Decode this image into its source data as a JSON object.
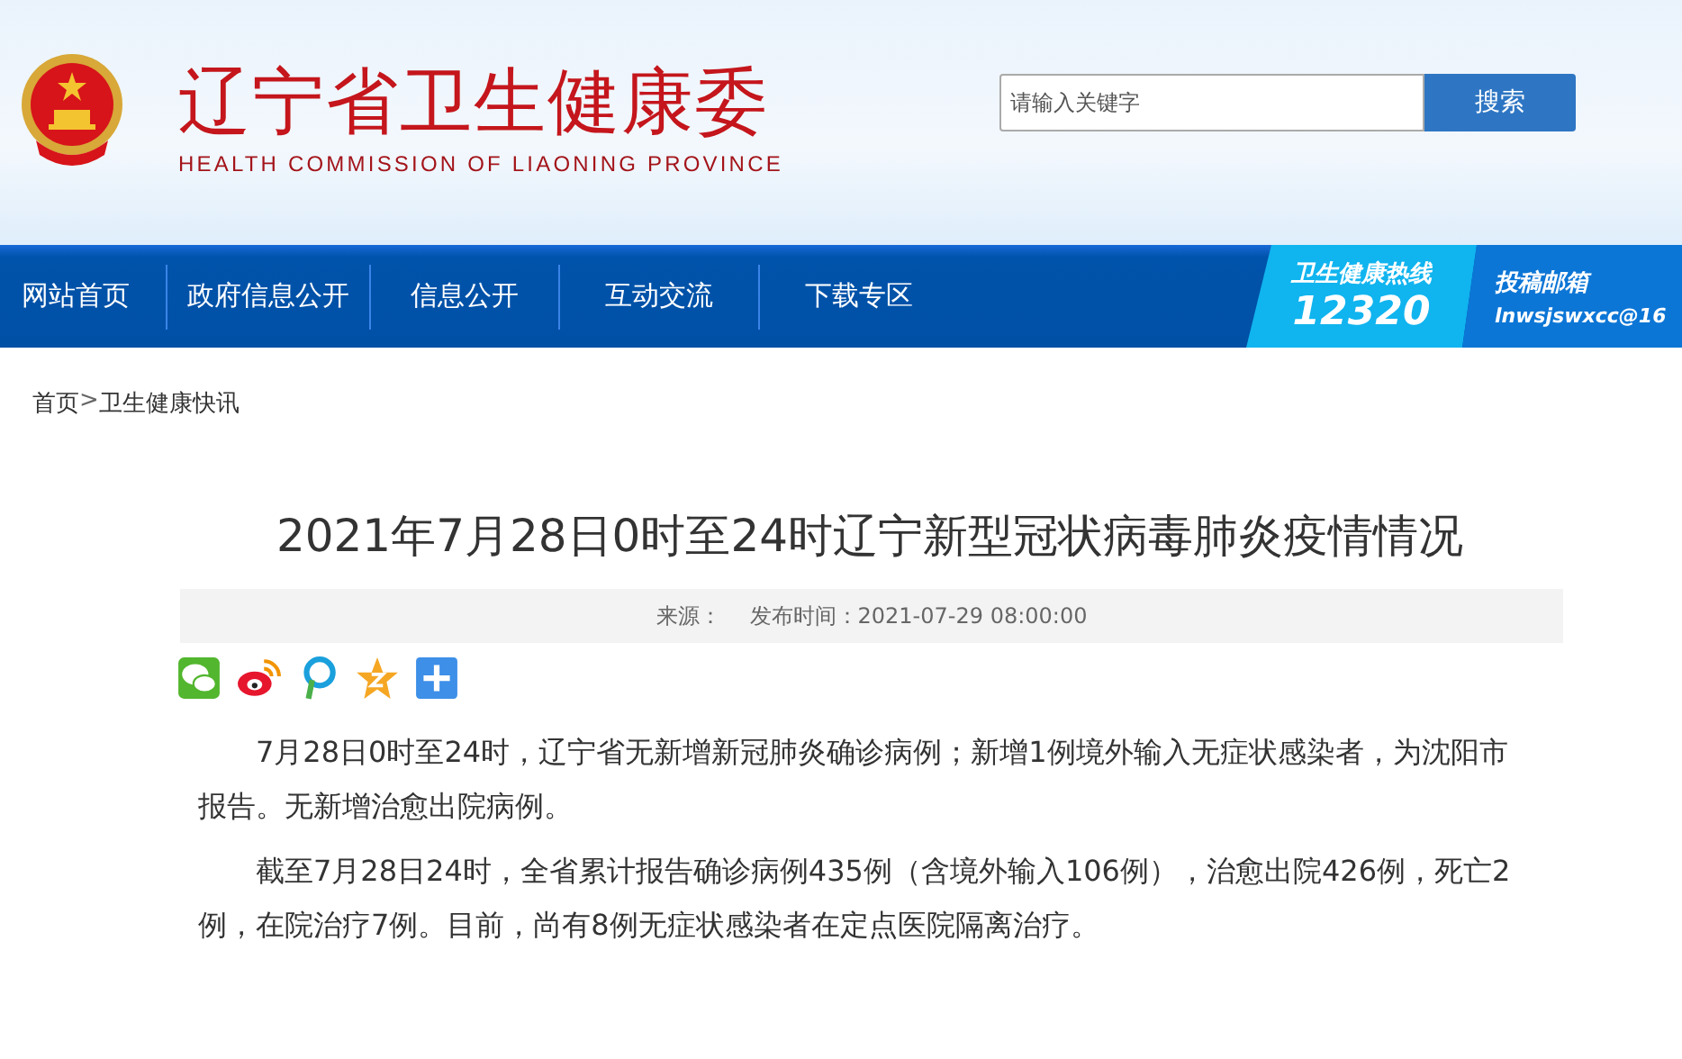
{
  "header": {
    "title": "辽宁省卫生健康委",
    "subtitle": "HEALTH COMMISSION OF LIAONING PROVINCE",
    "search": {
      "placeholder": "请输入关键字",
      "button": "搜索"
    }
  },
  "nav": {
    "items": [
      {
        "label": "网站首页"
      },
      {
        "label": "政府信息公开"
      },
      {
        "label": "信息公开"
      },
      {
        "label": "互动交流"
      },
      {
        "label": "下载专区"
      }
    ],
    "hotline": {
      "label": "卫生健康热线",
      "number": "12320"
    },
    "mailbox": {
      "label": "投稿邮箱",
      "address": "lnwsjswxcc@16"
    }
  },
  "breadcrumb": {
    "items": [
      "首页",
      "卫生健康快讯"
    ],
    "separator": ">"
  },
  "article": {
    "title": "2021年7月28日0时至24时辽宁新型冠状病毒肺炎疫情情况",
    "source_label": "来源：",
    "publish_time": "发布时间：2021-07-29 08:00:00",
    "share": [
      {
        "kind": "wechat"
      },
      {
        "kind": "weibo"
      },
      {
        "kind": "pin"
      },
      {
        "kind": "star"
      },
      {
        "kind": "plus"
      }
    ],
    "paragraphs": [
      "7月28日0时至24时，辽宁省无新增新冠肺炎确诊病例；新增1例境外输入无症状感染者，为沈阳市报告。无新增治愈出院病例。",
      "截至7月28日24时，全省累计报告确诊病例435例（含境外输入106例），治愈出院426例，死亡2例，在院治疗7例。目前，尚有8例无症状感染者在定点医院隔离治疗。"
    ]
  }
}
